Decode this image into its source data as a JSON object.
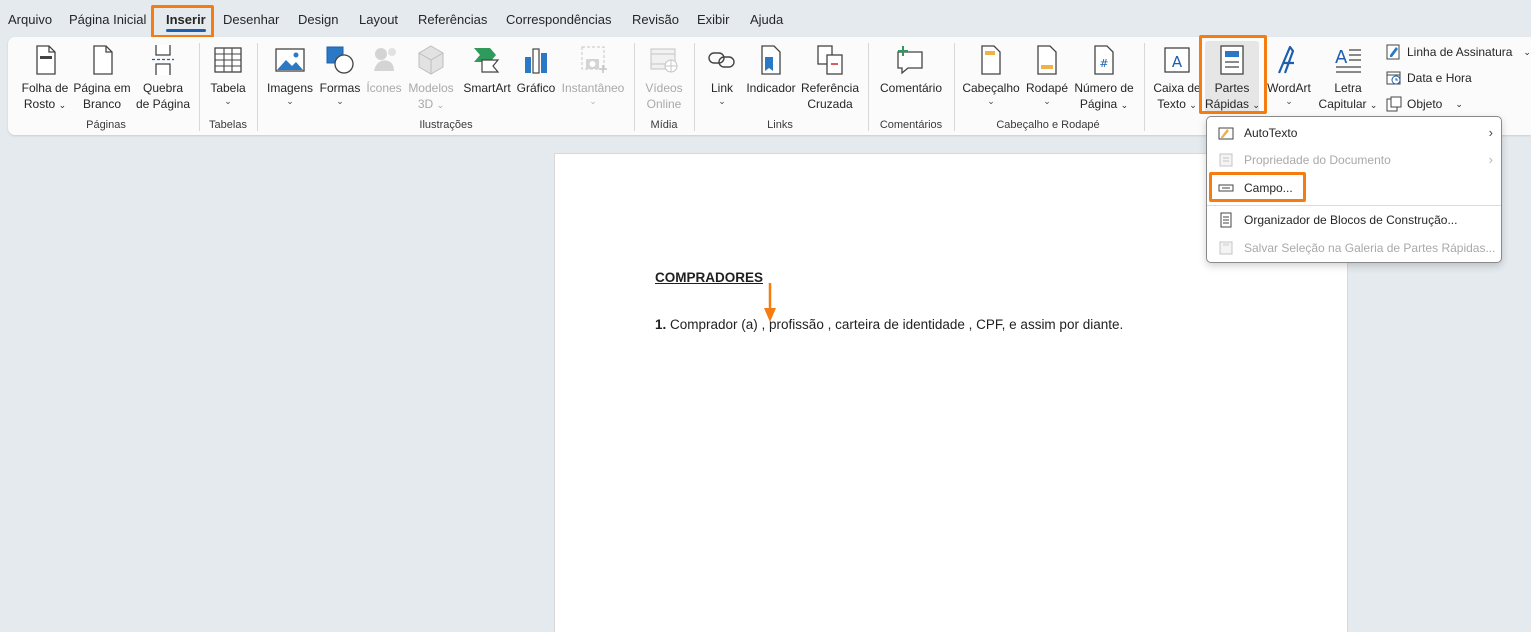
{
  "tabs": [
    "Arquivo",
    "Página Inicial",
    "Inserir",
    "Desenhar",
    "Design",
    "Layout",
    "Referências",
    "Correspondências",
    "Revisão",
    "Exibir",
    "Ajuda"
  ],
  "ribbon": {
    "folha_rosto": [
      "Folha de",
      "Rosto"
    ],
    "pagina_branco": [
      "Página em",
      "Branco"
    ],
    "quebra_pagina": [
      "Quebra",
      "de Página"
    ],
    "tabela": "Tabela",
    "imagens": "Imagens",
    "formas": "Formas",
    "icones": "Ícones",
    "modelos3d": [
      "Modelos",
      "3D"
    ],
    "smartart": "SmartArt",
    "grafico": "Gráfico",
    "instantaneo": "Instantâneo",
    "videos_online": [
      "Vídeos",
      "Online"
    ],
    "link": "Link",
    "indicador": "Indicador",
    "referencia_cruzada": [
      "Referência",
      "Cruzada"
    ],
    "comentario": "Comentário",
    "cabecalho": "Cabeçalho",
    "rodape": "Rodapé",
    "numero_pagina": [
      "Número de",
      "Página"
    ],
    "caixa_texto": [
      "Caixa de",
      "Texto"
    ],
    "partes_rapidas": [
      "Partes",
      "Rápidas"
    ],
    "wordart": "WordArt",
    "letra_capitular": [
      "Letra",
      "Capitular"
    ],
    "linha_assinatura": "Linha de Assinatura",
    "data_hora": "Data e Hora",
    "objeto": "Objeto",
    "groups": {
      "paginas": "Páginas",
      "tabelas": "Tabelas",
      "ilustracoes": "Ilustrações",
      "midia": "Mídia",
      "links": "Links",
      "comentarios": "Comentários",
      "cabecalho_rodape": "Cabeçalho e Rodapé"
    }
  },
  "menu": {
    "items": [
      {
        "label": "AutoTexto",
        "disabled": false,
        "submenu": true
      },
      {
        "label": "Propriedade do Documento",
        "disabled": true,
        "submenu": true
      },
      {
        "label": "Campo...",
        "disabled": false,
        "submenu": false
      },
      {
        "label": "Organizador de Blocos de Construção...",
        "disabled": false,
        "submenu": false
      },
      {
        "label": "Salvar Seleção na Galeria de Partes Rápidas...",
        "disabled": true,
        "submenu": false
      }
    ],
    "arrow": "›"
  },
  "document": {
    "heading": "COMPRADORES",
    "line_number": "1.",
    "line_text": " Comprador (a) , profissão , carteira de identidade , CPF, e assim por diante."
  },
  "chevron": "⌄",
  "colors": {
    "highlight": "#f47c10",
    "accent": "#1d5fae"
  }
}
